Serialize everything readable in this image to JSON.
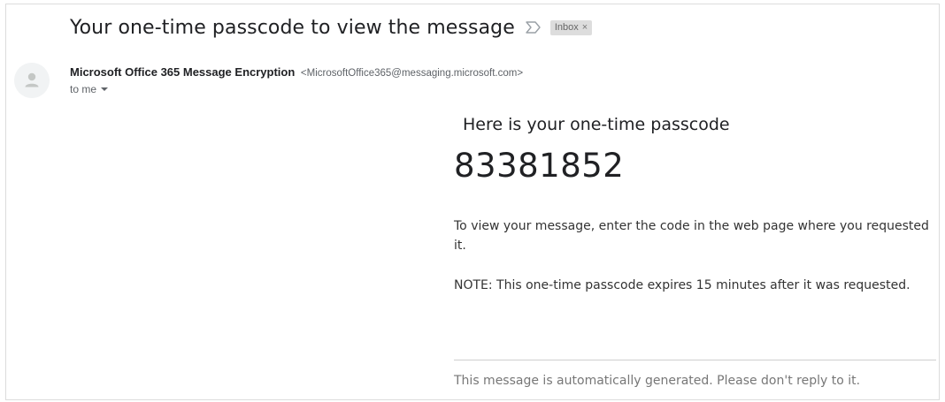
{
  "email": {
    "subject": "Your one-time passcode to view the message",
    "importance_icon": "importance-marker-icon",
    "label": {
      "text": "Inbox",
      "close_symbol": "×"
    },
    "sender": {
      "name": "Microsoft Office 365 Message Encryption",
      "email": "<MicrosoftOffice365@messaging.microsoft.com>",
      "avatar_icon": "person-avatar-icon"
    },
    "recipient": {
      "text": "to me",
      "dropdown_icon": "caret-down-icon"
    }
  },
  "message": {
    "heading": "Here is your one-time passcode",
    "passcode": "83381852",
    "instructions": "To view your message, enter the code in the web page where you requested it.",
    "note": "NOTE: This one-time passcode expires 15 minutes after it was requested.",
    "footer": "This message is automatically generated. Please don't reply to it."
  },
  "colors": {
    "text_primary": "#202124",
    "text_secondary": "#5f6368",
    "chip_background": "#dddddd",
    "divider": "#cfcfcf"
  }
}
